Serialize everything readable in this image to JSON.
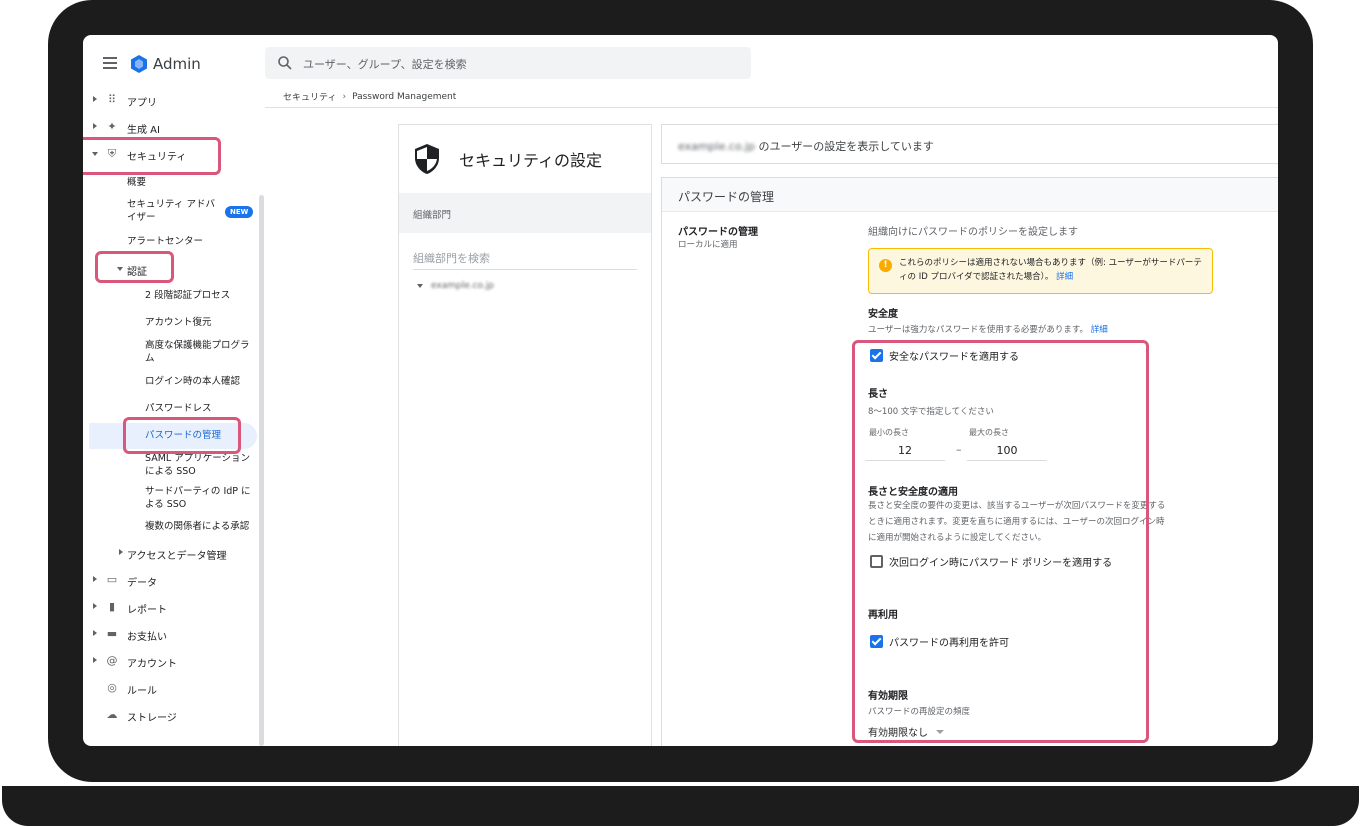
{
  "app": {
    "title": "Admin"
  },
  "search": {
    "placeholder": "ユーザー、グループ、設定を検索"
  },
  "breadcrumb": [
    "セキュリティ",
    "Password Management"
  ],
  "sidebar": {
    "apps": "アプリ",
    "gen_ai": "生成 AI",
    "security": "セキュリティ",
    "security_items": {
      "overview": "概要",
      "advisor": "セキュリティ アドバイザー",
      "advisor_badge": "NEW",
      "alert_center": "アラートセンター",
      "auth": "認証",
      "auth_items": {
        "two_step": "2 段階認証プロセス",
        "account_recovery": "アカウント復元",
        "advanced_protection": "高度な保護機能プログラム",
        "login_challenge": "ログイン時の本人確認",
        "passwordless": "パスワードレス",
        "password_management": "パスワードの管理",
        "saml_sso": "SAML アプリケーションによる SSO",
        "third_party_sso": "サードパーティの IdP による SSO",
        "multi_party": "複数の関係者による承認"
      },
      "access_data": "アクセスとデータ管理"
    },
    "data": "データ",
    "reports": "レポート",
    "billing": "お支払い",
    "account": "アカウント",
    "rules": "ルール",
    "storage": "ストレージ"
  },
  "mid": {
    "title": "セキュリティの設定",
    "section_label": "組織部門",
    "org_search_placeholder": "組織部門を検索",
    "org_name": "example.co.jp"
  },
  "right": {
    "info_domain": "example.co.jp",
    "info_suffix": "のユーザーの設定を表示しています",
    "section_title": "パスワードの管理",
    "pm_label": "パスワードの管理",
    "pm_sub": "ローカルに適用",
    "pm_desc": "組織向けにパスワードのポリシーを設定します",
    "warning": "これらのポリシーは適用されない場合もあります（例: ユーザーがサードパーティの ID プロバイダで認証された場合）。",
    "warning_link": "詳細",
    "strength": {
      "title": "安全度",
      "help": "ユーザーは強力なパスワードを使用する必要があります。",
      "help_link": "詳細",
      "checkbox": "安全なパスワードを適用する",
      "checked": true
    },
    "length": {
      "title": "長さ",
      "help": "8〜100 文字で指定してください",
      "min_label": "最小の長さ",
      "max_label": "最大の長さ",
      "min_value": "12",
      "max_value": "100",
      "dash": "–"
    },
    "enforcement": {
      "title": "長さと安全度の適用",
      "desc": "長さと安全度の要件の変更は、該当するユーザーが次回パスワードを変更するときに適用されます。変更を直ちに適用するには、ユーザーの次回ログイン時に適用が開始されるように設定してください。",
      "checkbox": "次回ログイン時にパスワード ポリシーを適用する",
      "checked": false
    },
    "reuse": {
      "title": "再利用",
      "checkbox": "パスワードの再利用を許可",
      "checked": true
    },
    "expiration": {
      "title": "有効期限",
      "help": "パスワードの再設定の頻度",
      "value": "有効期限なし"
    }
  },
  "colors": {
    "highlight": "#d9577b",
    "accent": "#1a73e8",
    "frame": "#1c1c1c"
  }
}
